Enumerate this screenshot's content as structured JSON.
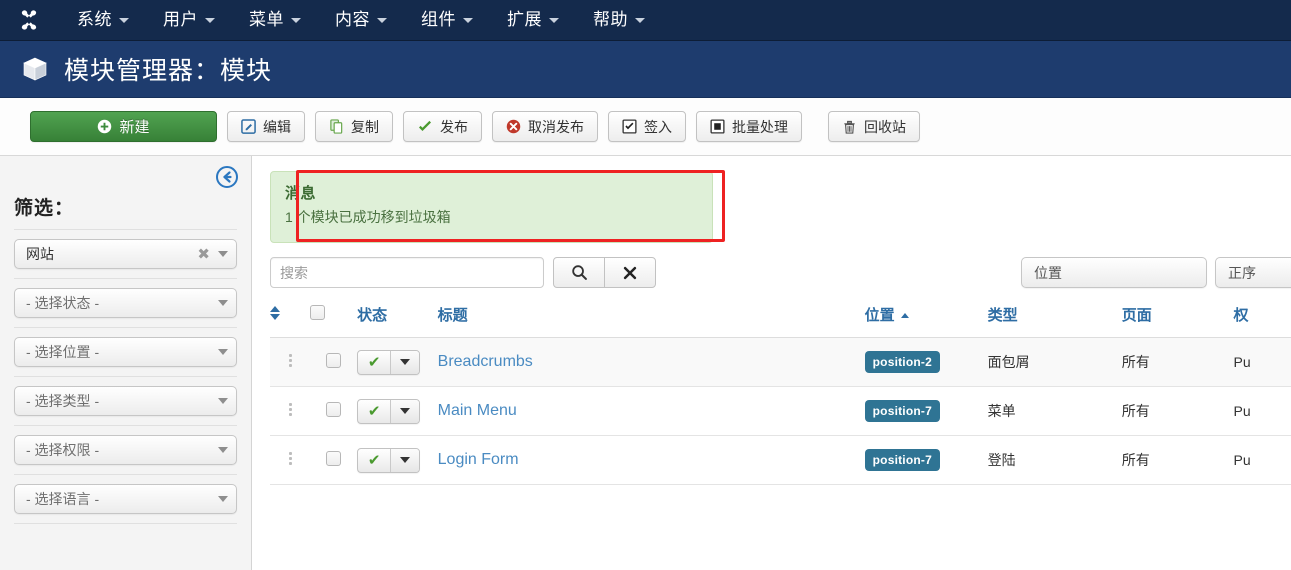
{
  "topnav": {
    "logo_icon": "joomla-logo-icon",
    "items": [
      {
        "label": "系统"
      },
      {
        "label": "用户"
      },
      {
        "label": "菜单"
      },
      {
        "label": "内容"
      },
      {
        "label": "组件"
      },
      {
        "label": "扩展"
      },
      {
        "label": "帮助"
      }
    ]
  },
  "header": {
    "icon": "cube-icon",
    "title": "模块管理器：模块"
  },
  "toolbar": {
    "new": {
      "label": "新建",
      "icon": "plus-circle-icon"
    },
    "edit": {
      "label": "编辑",
      "icon": "pencil-square-icon"
    },
    "copy": {
      "label": "复制",
      "icon": "copy-icon"
    },
    "publish": {
      "label": "发布",
      "icon": "check-icon"
    },
    "unpublish": {
      "label": "取消发布",
      "icon": "x-circle-icon"
    },
    "checkin": {
      "label": "签入",
      "icon": "checkbox-icon"
    },
    "batch": {
      "label": "批量处理",
      "icon": "square-icon"
    },
    "trash": {
      "label": "回收站",
      "icon": "trash-icon"
    }
  },
  "sidebar": {
    "collapse_icon": "circle-arrow-left-icon",
    "title": "筛选：",
    "filters": [
      {
        "label": "网站",
        "clearable": true,
        "selected": true
      },
      {
        "label": "- 选择状态 -",
        "clearable": false,
        "selected": false
      },
      {
        "label": "- 选择位置 -",
        "clearable": false,
        "selected": false
      },
      {
        "label": "- 选择类型 -",
        "clearable": false,
        "selected": false
      },
      {
        "label": "- 选择权限 -",
        "clearable": false,
        "selected": false
      },
      {
        "label": "- 选择语言 -",
        "clearable": false,
        "selected": false
      }
    ]
  },
  "message": {
    "title": "消息",
    "text": "1 个模块已成功移到垃圾箱"
  },
  "search": {
    "placeholder": "搜索",
    "value": "",
    "search_icon": "magnifier-icon",
    "clear_icon": "x-icon"
  },
  "listcontrols": {
    "sort_by": "位置",
    "sort_dir": "正序"
  },
  "table": {
    "headers": {
      "ordering": "",
      "checkall": "",
      "state": "状态",
      "title": "标题",
      "position": "位置",
      "type": "类型",
      "pages": "页面",
      "access": "权"
    },
    "sorted_column": "position",
    "sort_indicator": "ascending",
    "rows": [
      {
        "title": "Breadcrumbs",
        "state": "published",
        "position": "position-2",
        "type": "面包屑",
        "pages": "所有",
        "access": "Pu"
      },
      {
        "title": "Main Menu",
        "state": "published",
        "position": "position-7",
        "type": "菜单",
        "pages": "所有",
        "access": "Pu"
      },
      {
        "title": "Login Form",
        "state": "published",
        "position": "position-7",
        "type": "登陆",
        "pages": "所有",
        "access": "Pu"
      }
    ]
  },
  "highlights": {
    "trash_button": "#ee2222",
    "message_box": "#ee2222"
  },
  "colors": {
    "topnav_bg": "#142a4c",
    "subheader_bg": "#1e3c6e",
    "new_button": "#51a351",
    "badge": "#2f7494",
    "link": "#4a8bc2",
    "alert_bg": "#dff0d8"
  }
}
